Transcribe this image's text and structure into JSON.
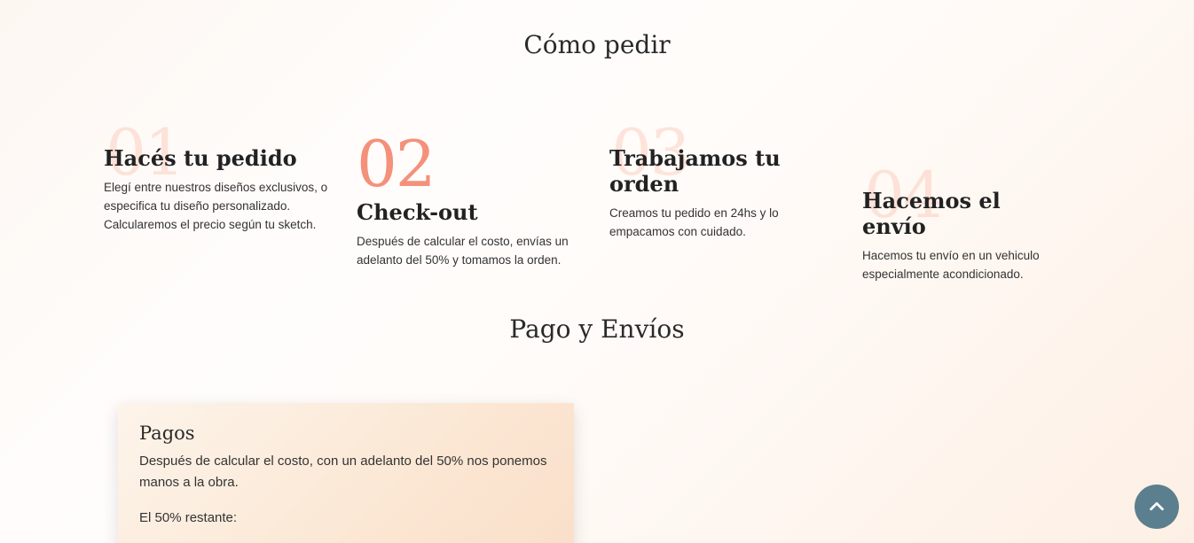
{
  "section_order": {
    "title": "Cómo pedir"
  },
  "steps": [
    {
      "number": "01",
      "title": "Hacés tu pedido",
      "text": "Elegí entre nuestros diseños exclusivos, o especifica tu diseño personalizado. Calcularemos el precio según tu sketch."
    },
    {
      "number": "02",
      "title": "Check-out",
      "text": "Después de calcular el costo, envías un adelanto del 50% y tomamos la orden."
    },
    {
      "number": "03",
      "title": "Trabajamos tu orden",
      "text": "Creamos tu pedido en 24hs y lo empacamos con cuidado."
    },
    {
      "number": "04",
      "title": "Hacemos el envío",
      "text": "Hacemos tu envío en un vehiculo especialmente acondicionado."
    }
  ],
  "section_payment": {
    "title": "Pago y Envíos"
  },
  "payment_card": {
    "title": "Pagos",
    "text": "Después de calcular el costo, con un adelanto del 50% nos ponemos manos a la obra.",
    "remaining": "El 50% restante:"
  },
  "scroll_top": {
    "icon": "chevron-up-icon"
  },
  "colors": {
    "accent": "#f4917a",
    "button": "#5b7f8e",
    "card": "#fbe7d4"
  }
}
